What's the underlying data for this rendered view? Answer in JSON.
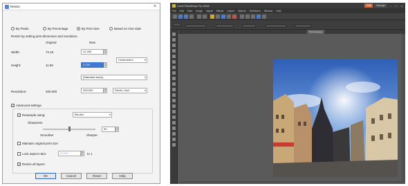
{
  "resize_dialog": {
    "title": "Resize",
    "close_glyph": "×",
    "modes": [
      {
        "label": "By Pixels",
        "selected": false
      },
      {
        "label": "By Percentage",
        "selected": false
      },
      {
        "label": "By Print Size",
        "selected": true
      },
      {
        "label": "Based on One Side",
        "selected": false
      }
    ],
    "section_heading": "Resize by setting print dimension and resolution.",
    "col_original": "Original",
    "col_new": "New",
    "rows": {
      "width": {
        "label": "Width:",
        "original": "72.15",
        "new": "22.450"
      },
      "height": {
        "label": "Height:",
        "original": "11.96",
        "new": "3.720"
      },
      "resolution": {
        "label": "Resolution:",
        "original": "200.000",
        "new": "200.000"
      }
    },
    "units": "Centimeters",
    "aspect_dropdown": "[Standard sizes]",
    "resolution_units": "Pixels / inch",
    "advanced_settings": {
      "label": "Advanced settings",
      "checked": true
    },
    "resample": {
      "label": "Resample using:",
      "checked": true,
      "method": "Bicubic"
    },
    "sharpness": {
      "label": "Sharpness",
      "value": "50",
      "left_label": "Smoother",
      "right_label": "Sharper",
      "level": 0.5
    },
    "maintain_original_size": {
      "label": "Maintain original print size",
      "checked": false
    },
    "lock_aspect": {
      "label": "Lock aspect ratio:",
      "checked": false,
      "value": "6.0337",
      "suffix": "to 1"
    },
    "resize_all_layers": {
      "label": "Resize all layers",
      "checked": true
    },
    "buttons": {
      "ok": "OK",
      "cancel": "Cancel",
      "reset": "Reset",
      "help": "Help"
    }
  },
  "psp": {
    "app_title": "Corel PaintShop Pro 2018",
    "workspaces": [
      "Edit",
      "Manage"
    ],
    "menu": [
      "File",
      "Edit",
      "View",
      "Image",
      "Adjust",
      "Effects",
      "Layers",
      "Objects",
      "Selections",
      "Window",
      "Help"
    ],
    "document_tab": "Panorama.jpg",
    "colors": {
      "accent": "#c9683a",
      "chrome": "#3b3b3b",
      "workspace": "#5a5a5a"
    }
  }
}
